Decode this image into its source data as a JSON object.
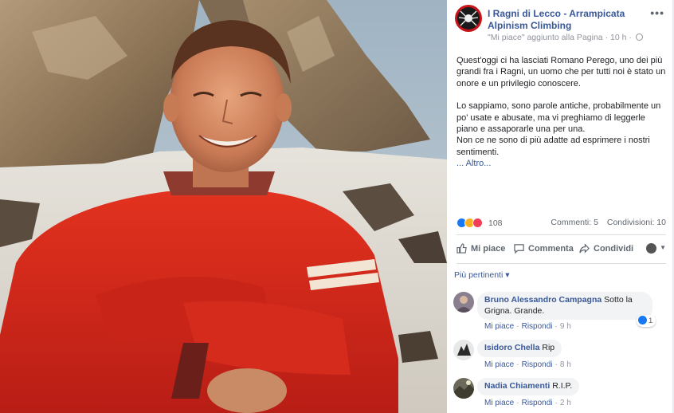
{
  "post": {
    "page_name": "I Ragni di Lecco - Arrampicata Alpinism Climbing",
    "meta_action": "\"Mi piace\" aggiunto alla Pagina",
    "meta_sep": "·",
    "meta_time": "10 h",
    "more_label": "•••",
    "paragraphs": [
      "Quest'oggi ci ha lasciati Romano Perego, uno dei più grandi fra i Ragni, un uomo che per tutti noi è stato un onore e un privilegio conoscere.",
      "Lo sappiamo, sono parole antiche, probabilmente un po' usate e abusate, ma vi preghiamo di leggerle piano e assaporarle una per una.",
      "Non ce ne sono di più adatte ad esprimere i nostri sentimenti."
    ],
    "more_link": "... Altro..."
  },
  "stats": {
    "reaction_count": "108",
    "comments": "Commenti: 5",
    "shares": "Condivisioni: 10"
  },
  "actions": {
    "like": "Mi piace",
    "comment": "Commenta",
    "share": "Condividi"
  },
  "comments_filter": "Più pertinenti ▾",
  "comments": [
    {
      "author": "Bruno Alessandro Campagna",
      "text": "Sotto la Grigna. Grande.",
      "like": "Mi piace",
      "reply": "Rispondi",
      "time": "9 h",
      "reactions": "1"
    },
    {
      "author": "Isidoro Chella",
      "text": "Rip",
      "like": "Mi piace",
      "reply": "Rispondi",
      "time": "8 h"
    },
    {
      "author": "Nadia Chiamenti",
      "text": "R.I.P.",
      "like": "Mi piace",
      "reply": "Rispondi",
      "time": "2 h"
    }
  ],
  "colors": {
    "link": "#385898",
    "sweater": "#d9261c",
    "like_blue": "#1877f2"
  }
}
